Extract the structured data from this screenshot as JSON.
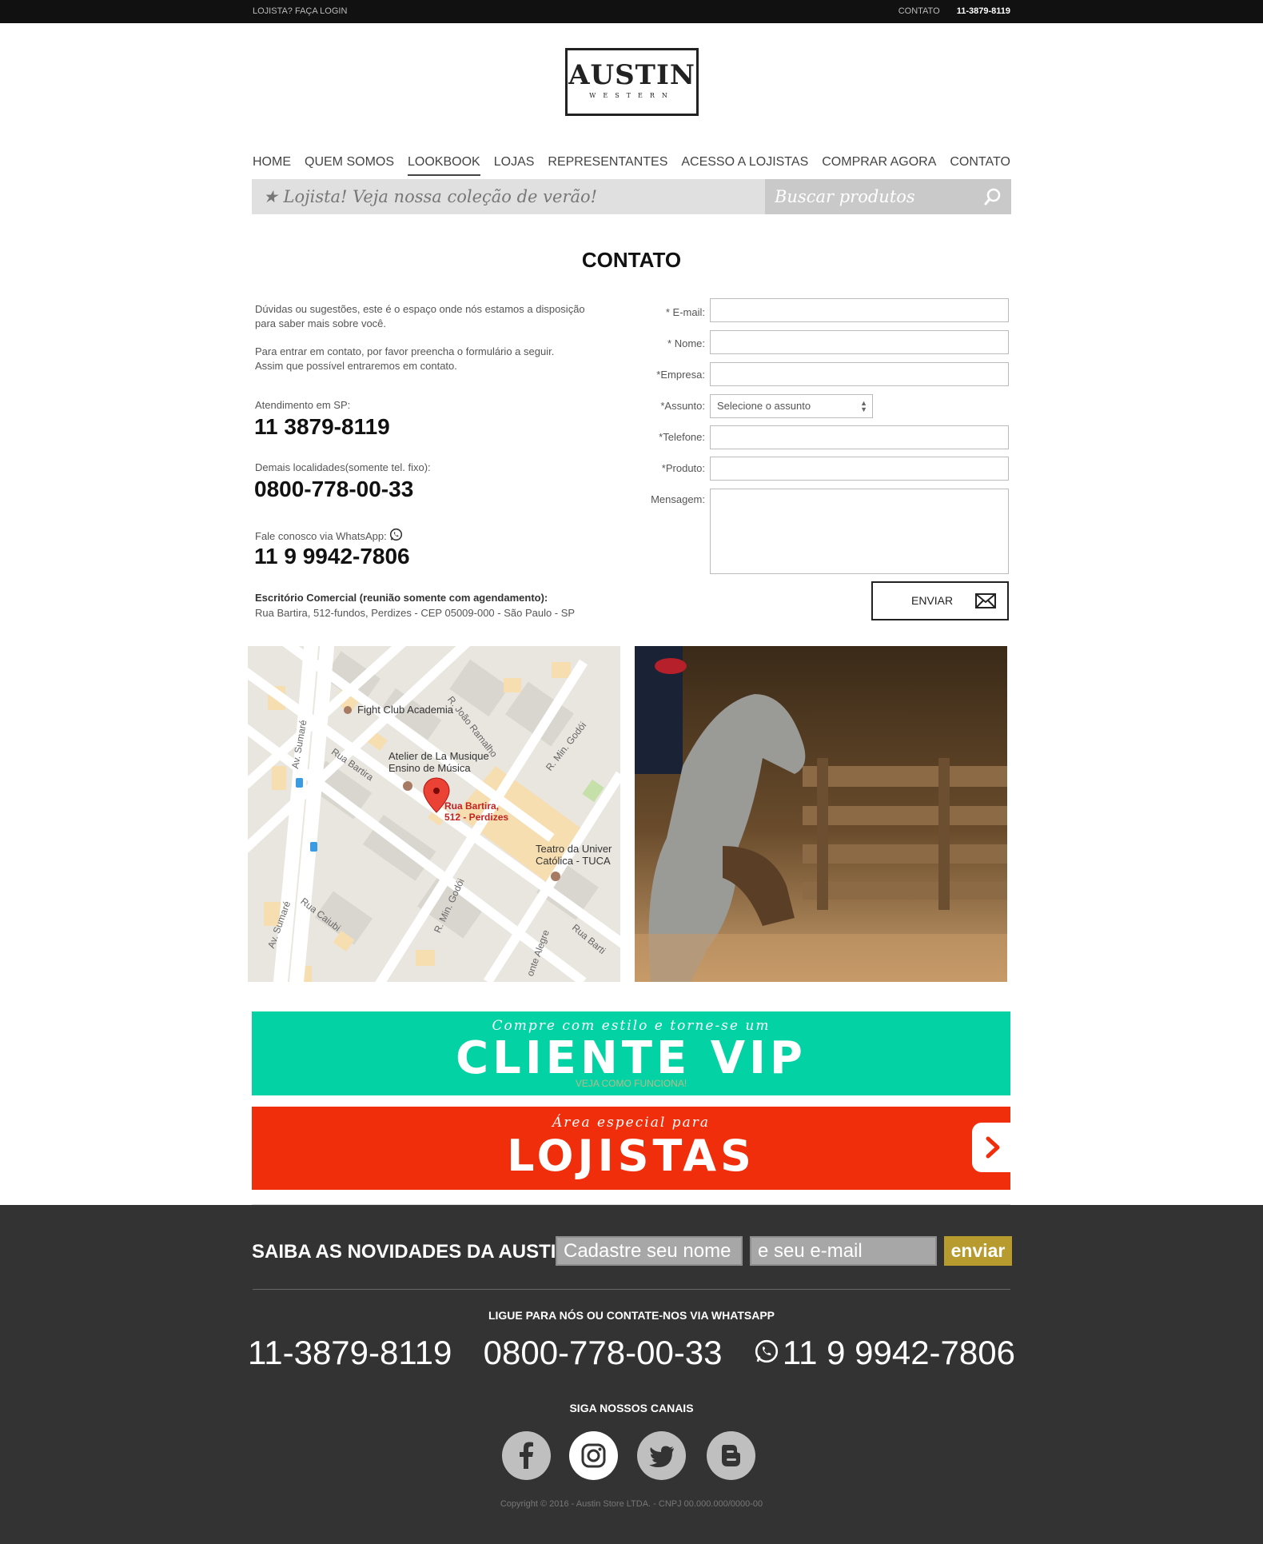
{
  "topbar": {
    "login": "LOJISTA? FAÇA LOGIN",
    "contact": "CONTATO",
    "phone": "11-3879-8119"
  },
  "logo": {
    "name": "AUSTIN",
    "tagline": "WESTERN"
  },
  "nav": [
    "HOME",
    "QUEM SOMOS",
    "LOOKBOOK",
    "LOJAS",
    "REPRESENTANTES",
    "ACESSO A LOJISTAS",
    "COMPRAR AGORA",
    "CONTATO"
  ],
  "nav_active": "LOOKBOOK",
  "promo": {
    "text": "★ Lojista! Veja nossa coleção de verão!",
    "search_placeholder": "Buscar produtos"
  },
  "contact": {
    "title": "CONTATO",
    "intro1": "Dúvidas ou sugestões, este é o espaço onde nós estamos a disposição para saber mais sobre você.",
    "intro2": "Para entrar em contato, por favor preencha o formulário a seguir. Assim que possível entraremos em contato.",
    "sp_label": "Atendimento em SP:",
    "sp_phone": "11 3879-8119",
    "other_label": "Demais localidades(somente tel. fixo):",
    "other_phone": "0800-778-00-33",
    "wa_label": "Fale conosco via WhatsApp:",
    "wa_phone": "11 9 9942-7806",
    "office_title": "Escritório Comercial (reunião somente com agendamento):",
    "office_address": "Rua Bartira, 512-fundos, Perdizes - CEP 05009-000 - São Paulo - SP"
  },
  "form": {
    "email": "* E-mail:",
    "name": "* Nome:",
    "company": "*Empresa:",
    "subject": "*Assunto:",
    "subject_value": "Selecione o assunto",
    "phone": "*Telefone:",
    "product": "*Produto:",
    "message": "Mensagem:",
    "send": "ENVIAR"
  },
  "map": {
    "fight_club": "Fight Club Academia",
    "atelier1": "Atelier de La Musique",
    "atelier2": "Ensino de Música",
    "pin1": "Rua Bartira,",
    "pin2": "512 - Perdizes",
    "teatro1": "Teatro da Univer",
    "teatro2": "Católica - TUCA",
    "st_joao": "R. João Ramalho",
    "st_min1": "R. Min. Godói",
    "st_min2": "R. Min. Godói",
    "st_sumare1": "Av. Sumaré",
    "st_sumare2": "Av. Sumaré",
    "st_bartira1": "Rua Bartira",
    "st_bartira2": "Rua Barti",
    "st_caiubi": "Rua Caiubi",
    "st_monte": "onte Alegre"
  },
  "vip": {
    "small": "Compre com estilo e torne-se um",
    "big": "CLIENTE VIP",
    "link": "VEJA COMO FUNCIONA!"
  },
  "lojistas": {
    "small": "Área especial para",
    "big": "LOJISTAS"
  },
  "newsletter": {
    "title": "SAIBA AS NOVIDADES DA AUSTIN:",
    "name_placeholder": "Cadastre seu nome",
    "email_placeholder": "e seu e-mail",
    "button": "enviar"
  },
  "footer": {
    "call": "LIGUE PARA NÓS OU CONTATE-NOS VIA WHATSAPP",
    "phone1": "11-3879-8119",
    "phone2": "0800-778-00-33",
    "phone3": "11 9 9942-7806",
    "follow": "SIGA NOSSOS CANAIS",
    "copyright": "Copyright © 2016 - Austin Store LTDA. - CNPJ 00.000.000/0000-00"
  },
  "social": [
    "facebook-icon",
    "instagram-icon",
    "twitter-icon",
    "blogger-icon"
  ],
  "colors": {
    "vip": "#03d3a4",
    "lojistas": "#f12e0c",
    "footer": "#333333",
    "enviar": "#b89b2f"
  }
}
